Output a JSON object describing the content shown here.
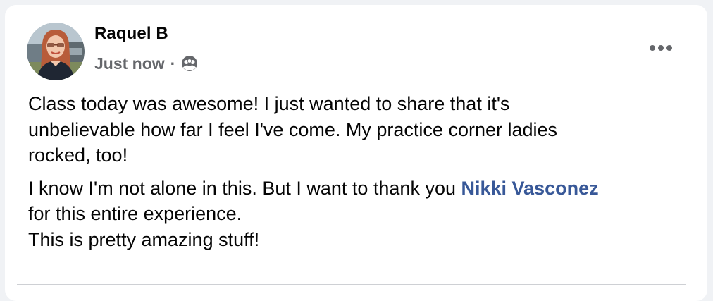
{
  "post": {
    "author": "Raquel B",
    "timestamp": "Just now",
    "separator": "·",
    "audience_icon": "friends-audience-icon",
    "menu_icon": "more-horizontal-icon",
    "paragraph_1": "Class today was awesome! I just wanted to share that it's\nunbelievable how far I feel I've come. My practice corner ladies\nrocked, too!",
    "paragraph_2_before": "I know I'm not alone in this. But I want to thank you ",
    "mention": "Nikki Vasconez",
    "paragraph_2_after": "\nfor this entire experience.\nThis is pretty amazing stuff!"
  },
  "colors": {
    "card_background": "#ffffff",
    "page_background": "#f0f2f5",
    "primary_text": "#050505",
    "secondary_text": "#65676b",
    "mention_link": "#385898"
  }
}
